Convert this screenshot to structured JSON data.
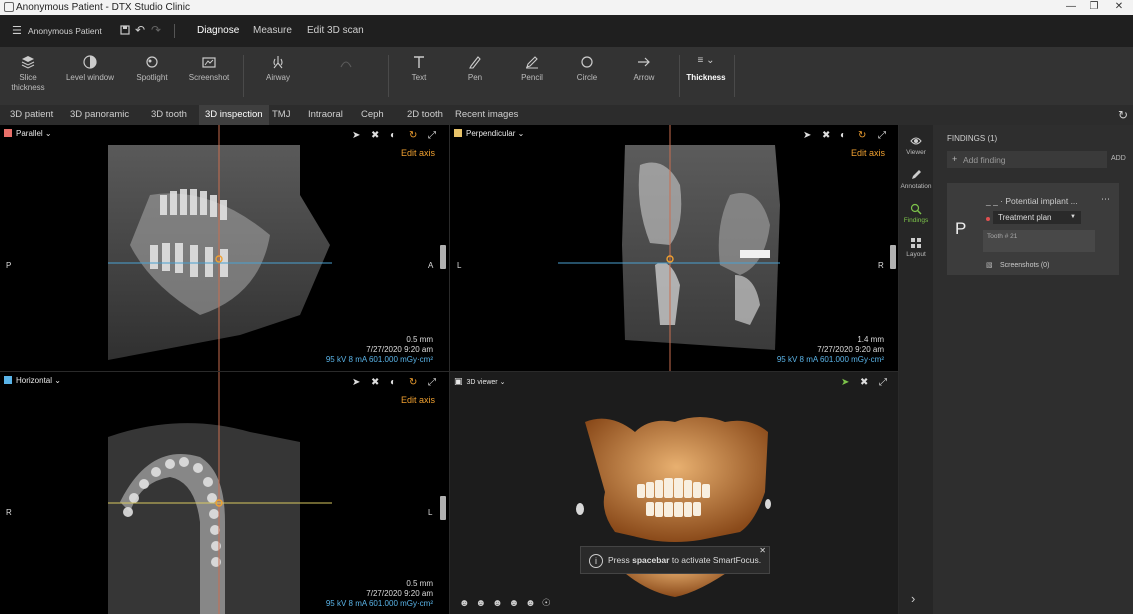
{
  "window": {
    "title": "Anonymous Patient - DTX Studio Clinic"
  },
  "menu": {
    "patient": "Anonymous Patient",
    "tabs": [
      "Diagnose",
      "Measure",
      "Edit 3D scan"
    ],
    "active_tab": "Diagnose"
  },
  "toolbar": {
    "slice_thickness": "Slice thickness",
    "level_window": "Level window",
    "spotlight": "Spotlight",
    "screenshot": "Screenshot",
    "airway": "Airway",
    "text": "Text",
    "pen": "Pen",
    "pencil": "Pencil",
    "circle": "Circle",
    "arrow": "Arrow",
    "thickness": "Thickness"
  },
  "view_tabs": [
    "3D patient",
    "3D panoramic",
    "3D tooth",
    "3D inspection",
    "TMJ",
    "Intraoral",
    "Ceph",
    "2D tooth",
    "Recent images"
  ],
  "active_view_tab": "3D inspection",
  "views": {
    "parallel": {
      "label": "Parallel",
      "edit_axis": "Edit axis",
      "left": "P",
      "right": "A",
      "thickness": "0.5 mm",
      "date": "7/27/2020 9:20 am",
      "params": "95 kV  8 mA  601.000 mGy·cm²",
      "color": "#e8706a"
    },
    "perpendicular": {
      "label": "Perpendicular",
      "edit_axis": "Edit axis",
      "left": "L",
      "right": "R",
      "thickness": "1.4 mm",
      "date": "7/27/2020 9:20 am",
      "params": "95 kV  8 mA  601.000 mGy·cm²",
      "color": "#e8c36a"
    },
    "horizontal": {
      "label": "Horizontal",
      "edit_axis": "Edit axis",
      "left": "R",
      "right": "L",
      "thickness": "0.5 mm",
      "date": "7/27/2020 9:20 am",
      "params": "95 kV  8 mA  601.000 mGy·cm²",
      "color": "#5ab4e8"
    },
    "viewer3d": {
      "label": "3D viewer",
      "toast_pre": "Press",
      "toast_key": "spacebar",
      "toast_post": "to activate SmartFocus."
    }
  },
  "sidenav": {
    "viewer": "Viewer",
    "annotation": "Annotation",
    "findings": "Findings",
    "layout": "Layout"
  },
  "findings": {
    "header": "FINDINGS (1)",
    "add_placeholder": "Add finding",
    "add_button": "ADD",
    "card": {
      "initial": "P",
      "title": "_ _ · Potential implant ...",
      "plan": "Treatment plan",
      "tooth": "Tooth # 21",
      "screenshots": "Screenshots (0)"
    }
  },
  "colors": {
    "accent": "#f0a030",
    "info": "#5ab4e8",
    "active_green": "#7cc24a"
  }
}
